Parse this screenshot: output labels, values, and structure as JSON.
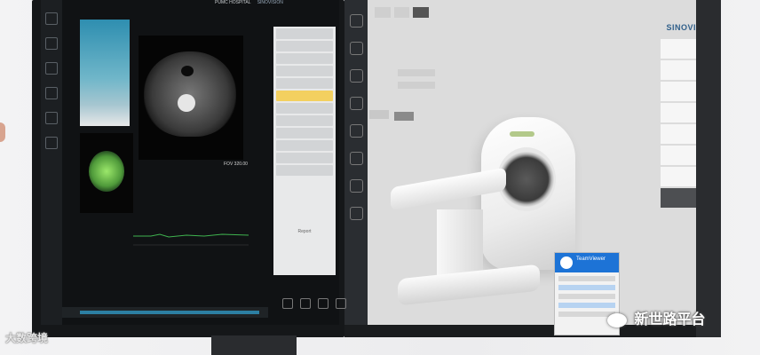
{
  "left_monitor": {
    "header_text": "PUMC HOSPITAL",
    "brand_text": "SINOVISION",
    "info_text": "FOV 320.00",
    "bottom_label": "Report"
  },
  "right_monitor": {
    "tabs": [
      "",
      "",
      ""
    ],
    "logo": "SINOVISION",
    "menu_items": [
      "",
      "",
      "",
      "",
      "",
      "",
      "",
      ""
    ],
    "active_menu_index": 7,
    "field_labels": [
      "",
      ""
    ],
    "buttons": [
      "",
      ""
    ],
    "teamviewer": {
      "title": "TeamViewer"
    }
  },
  "watermarks": {
    "left": "大数跨境",
    "right": "新世路平台"
  },
  "colors": {
    "accent": "#2f5f8a",
    "teamviewer": "#1d73d6",
    "ct_green": "#9ce86b"
  }
}
